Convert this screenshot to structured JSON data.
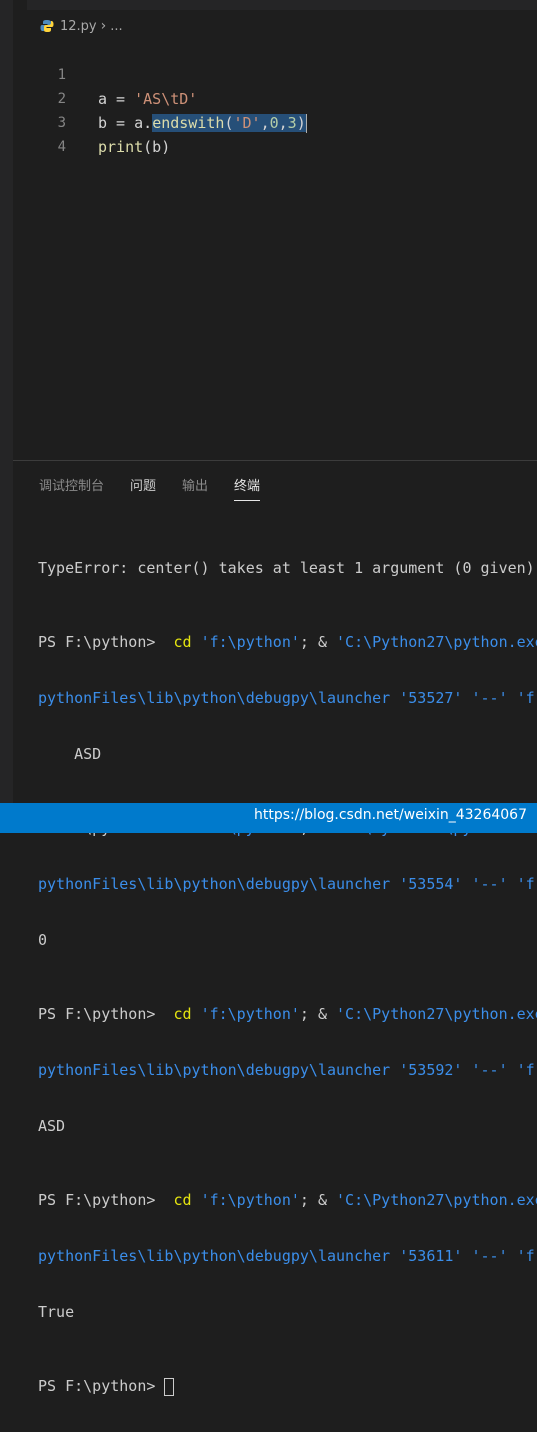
{
  "breadcrumb": {
    "file": "12.py",
    "separator": "›",
    "rest": "..."
  },
  "editor": {
    "line_numbers": [
      "1",
      "2",
      "3",
      "4"
    ],
    "l1": {
      "a": "a = ",
      "str": "'AS\\tD'"
    },
    "l2": {
      "pre": "b = a.",
      "fn": "endswith",
      "open": "(",
      "str": "'D'",
      "comma1": ",",
      "n1": "0",
      "comma2": ",",
      "n2": "3",
      "close": ")"
    },
    "l3": {
      "fn": "print",
      "args": "(b)"
    }
  },
  "panel": {
    "tabs": [
      "调试控制台",
      "问题",
      "输出",
      "终端"
    ],
    "active_tab": "终端"
  },
  "terminal": {
    "error_line": "TypeError: center() takes at least 1 argument (0 given)",
    "prompt": "PS F:\\python> ",
    "cmd": " cd ",
    "cd_path": "'f:\\python'",
    "sep": "; & ",
    "exe": "'C:\\Python27\\python.exe'",
    "launcher_path": "pythonFiles\\lib\\python\\debugpy\\launcher",
    "sp": " ",
    "dashdash": "'--'",
    "tail": "'f",
    "ports": [
      "'53527'",
      "'53554'",
      "'53592'",
      "'53611'"
    ],
    "outputs": [
      "    ASD",
      "0",
      "ASD",
      "True"
    ]
  },
  "watermark": "https://blog.csdn.net/weixin_43264067",
  "colors": {
    "accent": "#007acc",
    "editor_bg": "#1e1e1e",
    "string": "#ce9178",
    "selection": "#264f78"
  }
}
